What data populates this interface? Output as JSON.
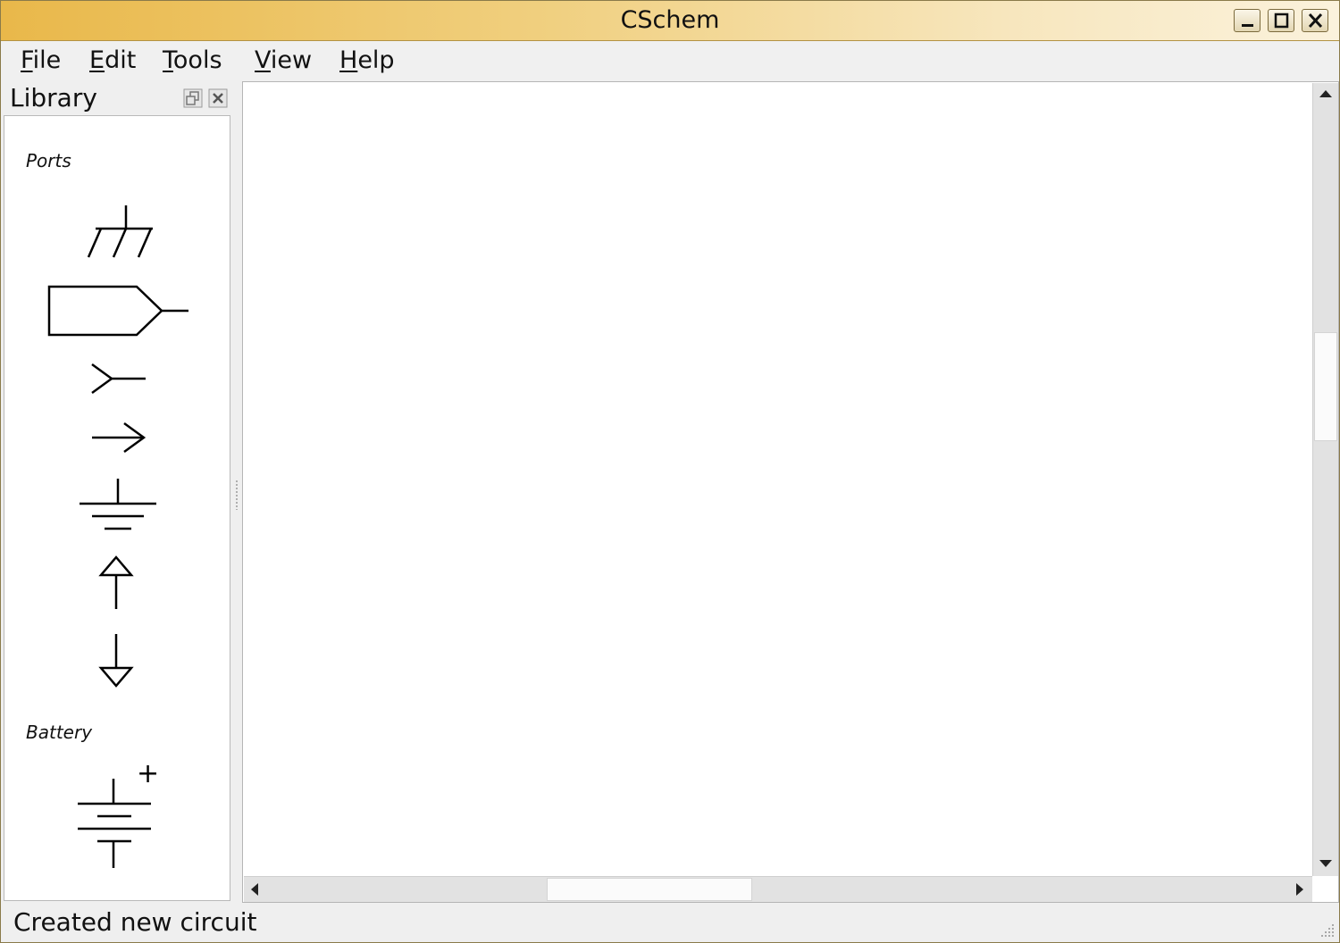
{
  "window": {
    "title": "CSchem",
    "title_gradient": [
      "#e9b84a",
      "#fbf2dc"
    ],
    "controls": [
      "minimize-icon",
      "maximize-icon",
      "close-icon"
    ]
  },
  "menu": {
    "items": [
      {
        "key": "F",
        "rest": "ile"
      },
      {
        "key": "E",
        "rest": "dit"
      },
      {
        "key": "T",
        "rest": "ools"
      },
      {
        "key": "V",
        "rest": "iew"
      },
      {
        "key": "H",
        "rest": "elp"
      }
    ]
  },
  "library": {
    "title": "Library",
    "dock_buttons": [
      "float-icon",
      "close-icon"
    ],
    "categories": [
      {
        "name": "Ports",
        "symbols": [
          "chassis-ground-icon",
          "port-label-icon",
          "input-port-icon",
          "arrow-port-icon",
          "ground-icon",
          "supply-up-icon",
          "supply-down-icon"
        ]
      },
      {
        "name": "Battery",
        "symbols": [
          "battery-icon"
        ],
        "battery_plus": "+"
      }
    ]
  },
  "status": {
    "message": "Created new circuit"
  }
}
